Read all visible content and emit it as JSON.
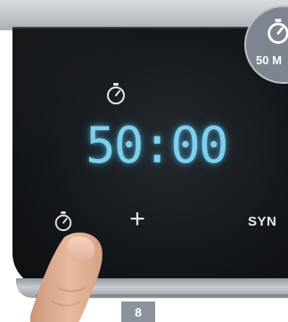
{
  "display": {
    "time": "50:00"
  },
  "controls": {
    "plus_label": "+",
    "sync_label": "SYN"
  },
  "badge": {
    "label": "50 M",
    "icon": "timer-icon"
  },
  "page": {
    "number": "8"
  },
  "colors": {
    "display_glow": "#7fd0ea",
    "panel": "#15181b",
    "badge": "#7d8690",
    "page_tab": "#8a939c"
  }
}
